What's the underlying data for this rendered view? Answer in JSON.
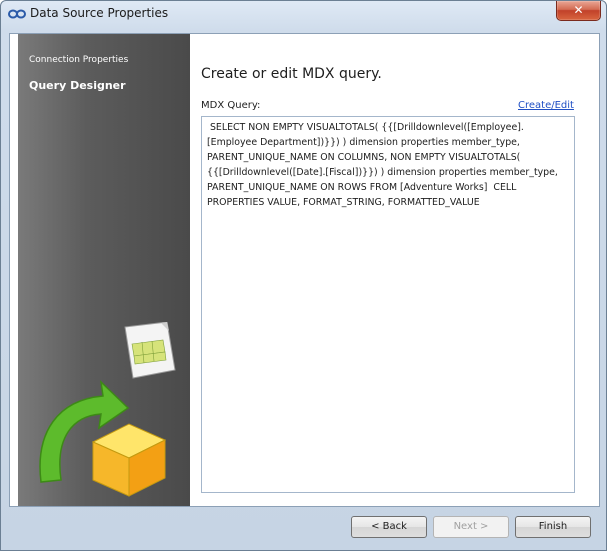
{
  "window": {
    "title": "Data Source Properties",
    "close_glyph": "✕"
  },
  "sidebar": {
    "items": [
      {
        "label": "Connection Properties"
      },
      {
        "label": "Query Designer"
      }
    ]
  },
  "main": {
    "heading": "Create or edit MDX query.",
    "query_label": "MDX Query:",
    "create_edit_link": "Create/Edit",
    "query_text": " SELECT NON EMPTY VISUALTOTALS( {{[Drilldownlevel([Employee].[Employee Department])}}) ) dimension properties member_type, PARENT_UNIQUE_NAME ON COLUMNS, NON EMPTY VISUALTOTALS( {{[Drilldownlevel([Date].[Fiscal])}}) ) dimension properties member_type, PARENT_UNIQUE_NAME ON ROWS FROM [Adventure Works]  CELL PROPERTIES VALUE, FORMAT_STRING, FORMATTED_VALUE"
  },
  "footer": {
    "back_label": "< Back",
    "next_label": "Next >",
    "finish_label": "Finish"
  },
  "icons": {
    "app": "link-icon",
    "spreadsheet": "spreadsheet-document-icon",
    "arrow": "green-arrow-icon",
    "cube": "cube-icon"
  },
  "colors": {
    "sidebar_bg": "#5c5c5c",
    "link": "#1f4fc4",
    "close_button": "#c1412a"
  }
}
